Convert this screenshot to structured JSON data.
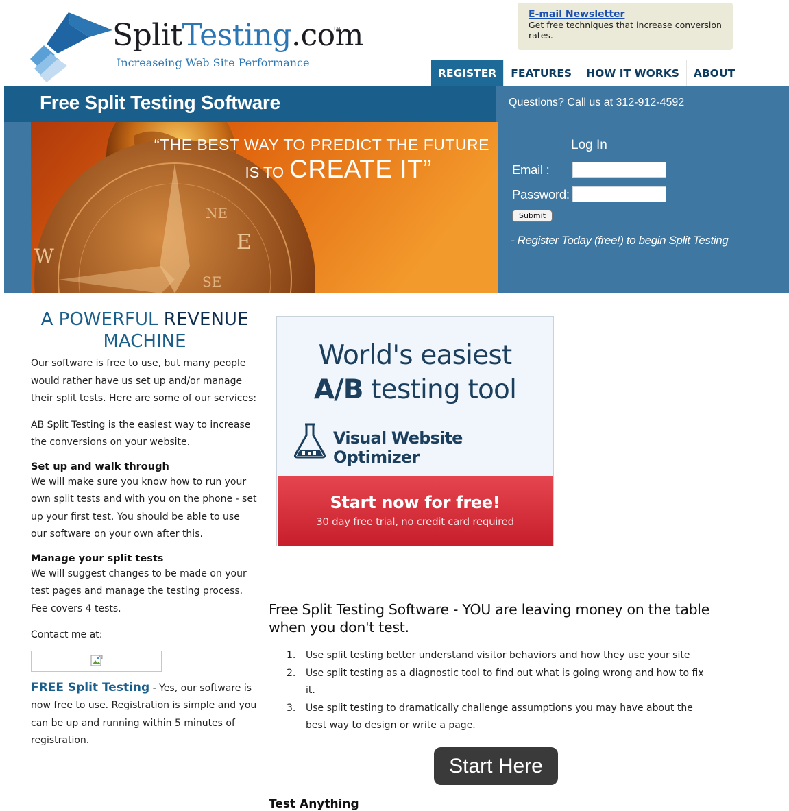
{
  "logo": {
    "split": "Split",
    "testing": "Testing",
    "dotcom": ".com",
    "tm": "TM",
    "tagline": "Increaseing Web Site Performance"
  },
  "newsletter": {
    "title": "E-mail Newsletter",
    "description": "Get free techniques that increase conversion rates."
  },
  "nav": {
    "tabs": [
      {
        "label": "REGISTER",
        "active": true
      },
      {
        "label": "FEATURES",
        "active": false
      },
      {
        "label": "HOW IT WORKS",
        "active": false
      },
      {
        "label": "ABOUT",
        "active": false
      }
    ]
  },
  "banner": {
    "title": "Free Split Testing Software",
    "questions": "Questions? Call us at 312-912-4592",
    "quote_line1": "“THE BEST WAY TO PREDICT THE FUTURE",
    "quote_small": "IS TO",
    "quote_big": "CREATE IT”"
  },
  "login": {
    "title": "Log In",
    "email_label": "Email :",
    "password_label": "Password:",
    "email_value": "",
    "password_value": "",
    "submit_label": "Submit",
    "register_prefix": "- ",
    "register_link": "Register Today",
    "register_suffix": " (free!) to begin Split Testing"
  },
  "left": {
    "heading_part1": "A POWERFUL",
    "heading_part2": "REVENUE",
    "heading_line2": "MACHINE",
    "intro": "Our software is free to use, but many people would rather have us set up and/or manage their split tests. Here are some of our services:",
    "ab_text": "AB Split Testing is the easiest way to increase the conversions on your website.",
    "setup_title": "Set up and walk through",
    "setup_text": "We will make sure you know how to run your own split tests and with you on the phone - set up your first test. You should be able to use our software on your own after this.",
    "manage_title": "Manage your split tests",
    "manage_text": "We will suggest changes to be made on your test pages and manage the testing process. Fee covers 4 tests.",
    "contact_text": "Contact me at:",
    "free_title": "FREE Split Testing",
    "free_text": " - Yes, our software is now free to use. Registration is simple and you can be up and running within 5 minutes of registration."
  },
  "ad": {
    "line1": "World's easiest",
    "line2_bold": "A/B",
    "line2_rest": " testing tool",
    "brand": "Visual Website Optimizer",
    "cta_title": "Start now for free!",
    "cta_sub": "30 day free trial, no credit card required"
  },
  "main": {
    "pitch": "Free Split Testing Software - YOU are leaving money on the table when you don't test.",
    "steps": [
      {
        "num": "1.",
        "text": "Use split testing better understand visitor behaviors and how they use your site"
      },
      {
        "num": "2.",
        "text": "Use split testing as a diagnostic tool to find out what is going wrong and how to fix it."
      },
      {
        "num": "3.",
        "text": "Use split testing to dramatically challenge assumptions you may have about the best way to design or write a page."
      }
    ],
    "start_label": "Start Here",
    "test_anything": "Test Anything"
  },
  "colors": {
    "brand_blue": "#2c77b3",
    "banner_blue": "#3d77a2",
    "nav_active": "#1d6a98",
    "cta_red": "#d62d38"
  },
  "icons": [
    "logo-arrow-icon",
    "broken-image-icon",
    "flask-icon"
  ]
}
